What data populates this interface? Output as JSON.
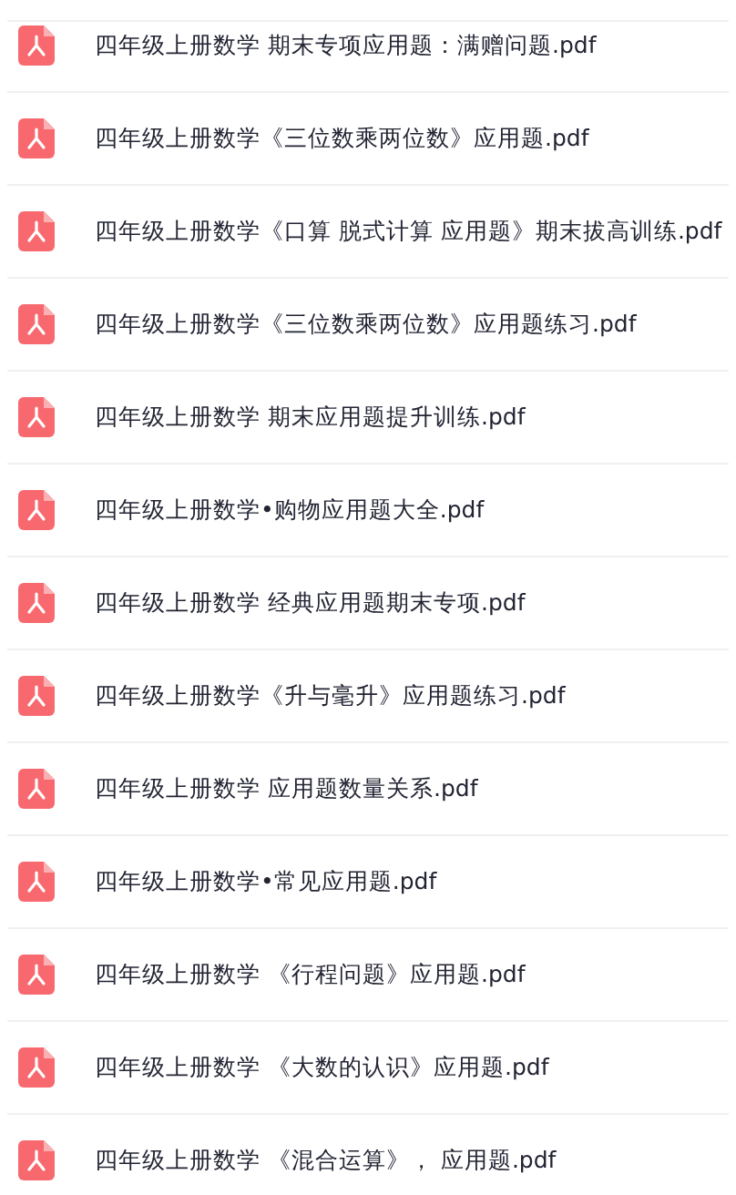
{
  "files": [
    {
      "name": "四年级上册数学 期末专项应用题：满赠问题.pdf"
    },
    {
      "name": "四年级上册数学《三位数乘两位数》应用题.pdf"
    },
    {
      "name": "四年级上册数学《口算 脱式计算 应用题》期末拔高训练.pdf"
    },
    {
      "name": "四年级上册数学《三位数乘两位数》应用题练习.pdf"
    },
    {
      "name": "四年级上册数学 期末应用题提升训练.pdf"
    },
    {
      "name": "四年级上册数学•购物应用题大全.pdf"
    },
    {
      "name": "四年级上册数学 经典应用题期末专项.pdf"
    },
    {
      "name": "四年级上册数学《升与毫升》应用题练习.pdf"
    },
    {
      "name": "四年级上册数学 应用题数量关系.pdf"
    },
    {
      "name": "四年级上册数学•常见应用题.pdf"
    },
    {
      "name": "四年级上册数学 《行程问题》应用题.pdf"
    },
    {
      "name": "四年级上册数学 《大数的认识》应用题.pdf"
    },
    {
      "name": "四年级上册数学 《混合运算》， 应用题.pdf"
    }
  ]
}
